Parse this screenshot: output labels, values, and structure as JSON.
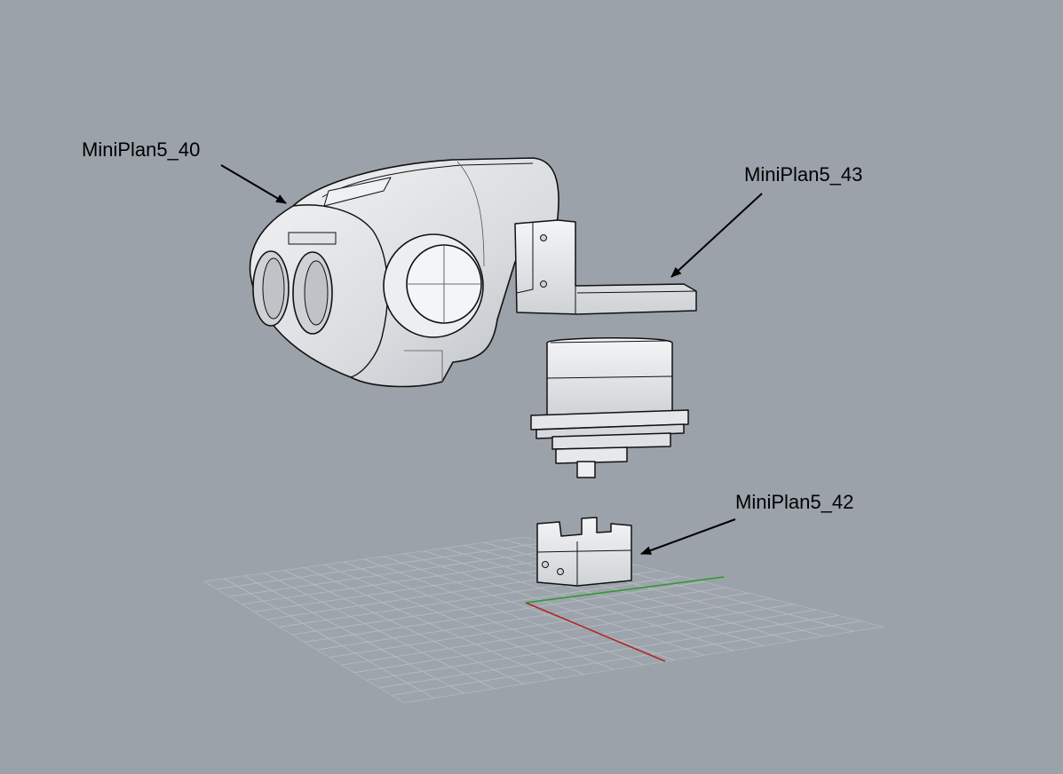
{
  "viewport": {
    "background_color": "#9ca2aa",
    "grid_line_color": "#b4b9c0",
    "axis_x_color": "#b3262a",
    "axis_y_color": "#2e9a2e",
    "part_fill_color": "#e8eaec",
    "part_edge_color": "#111111"
  },
  "annotations": [
    {
      "id": "40",
      "text": "MiniPlan5_40"
    },
    {
      "id": "43",
      "text": "MiniPlan5_43"
    },
    {
      "id": "42",
      "text": "MiniPlan5_42"
    }
  ]
}
